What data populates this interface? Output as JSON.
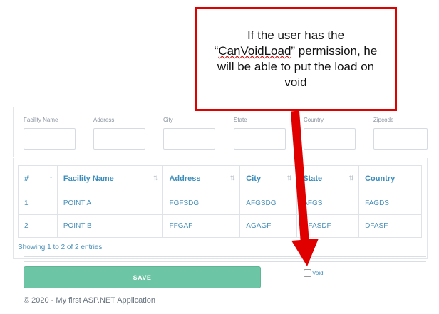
{
  "filters": [
    {
      "label": "Facility Name",
      "value": ""
    },
    {
      "label": "Address",
      "value": ""
    },
    {
      "label": "City",
      "value": ""
    },
    {
      "label": "State",
      "value": ""
    },
    {
      "label": "Country",
      "value": ""
    },
    {
      "label": "Zipcode",
      "value": ""
    }
  ],
  "table": {
    "headers": [
      "#",
      "Facility Name",
      "Address",
      "City",
      "State",
      "Country"
    ],
    "rows": [
      [
        "1",
        "POINT A",
        "FGFSDG",
        "AFGSDG",
        "AFGS",
        "FAGDS"
      ],
      [
        "2",
        "POINT B",
        "FFGAF",
        "AGAGF",
        "DFASDF",
        "DFASF"
      ]
    ],
    "info": "Showing 1 to 2 of 2 entries"
  },
  "form": {
    "save_label": "SAVE",
    "void_label": "Void",
    "void_checked": false
  },
  "footer": "© 2020 - My first ASP.NET Application",
  "callout": {
    "line1": "If the user has the",
    "line2a": "“",
    "line2b": "CanVoidLoad",
    "line2c": "” permission, he",
    "line3": "will be able to put the load on",
    "line4": "void",
    "border_color": "#e00000"
  },
  "colors": {
    "accent": "#3c8dbc",
    "save": "#6cc5a4",
    "callout": "#e00000"
  }
}
